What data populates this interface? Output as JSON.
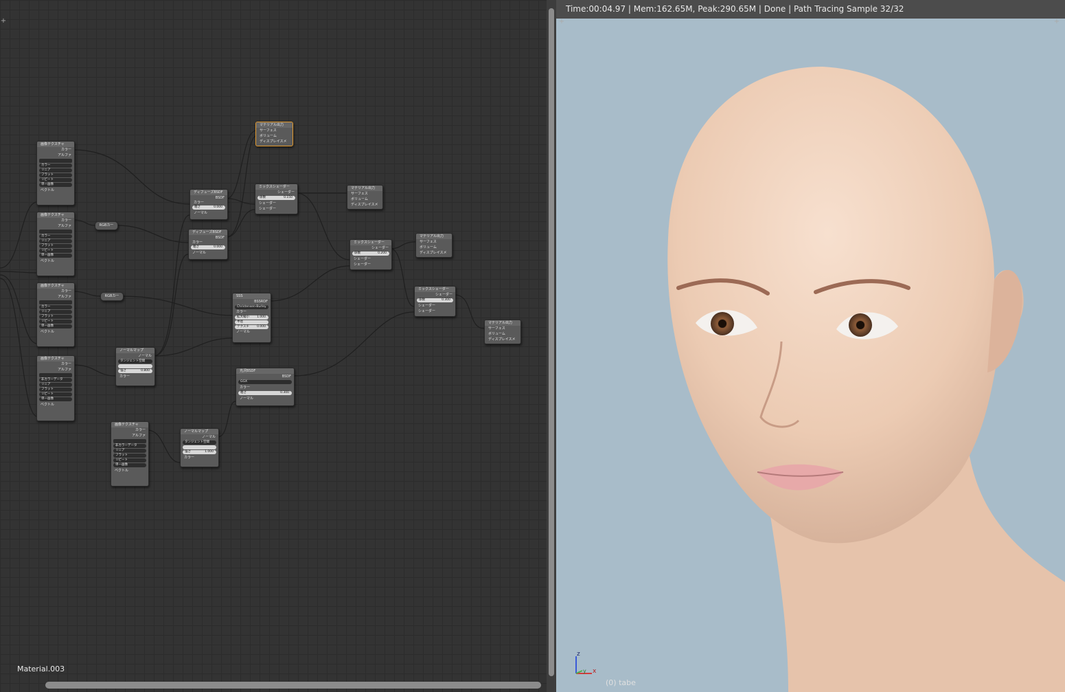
{
  "node_editor": {
    "material_name": "Material.003",
    "nodes": {
      "tex1": {
        "title": "画像テクスチャ",
        "color": "カラー",
        "alpha": "アルファ",
        "f1": "カラー",
        "f2": "リニア",
        "f3": "フラット",
        "f4": "リピート",
        "f5": "単一画像",
        "vector": "ベクトル"
      },
      "tex2": {
        "title": "画像テクスチャ",
        "color": "カラー",
        "alpha": "アルファ",
        "f1": "カラー",
        "f2": "リニア",
        "f3": "フラット",
        "f4": "リピート",
        "f5": "単一画像",
        "vector": "ベクトル"
      },
      "tex3": {
        "title": "画像テクスチャ",
        "color": "カラー",
        "alpha": "アルファ",
        "f1": "カラー",
        "f2": "リニア",
        "f3": "フラット",
        "f4": "リピート",
        "f5": "単一画像",
        "vector": "ベクトル"
      },
      "tex4": {
        "title": "画像テクスチャ",
        "color": "カラー",
        "alpha": "アルファ",
        "f1": "非カラーデータ",
        "f2": "リニア",
        "f3": "フラット",
        "f4": "リピート",
        "f5": "単一画像",
        "vector": "ベクトル"
      },
      "tex5": {
        "title": "画像テクスチャ",
        "color": "カラー",
        "alpha": "アルファ",
        "f1": "非カラーデータ",
        "f2": "リニア",
        "f3": "フラット",
        "f4": "リピート",
        "f5": "単一画像",
        "vector": "ベクトル"
      },
      "reroute1": {
        "label": "RGBカー"
      },
      "reroute2": {
        "label": "RGBカー"
      },
      "diffuse1": {
        "title": "ディフューズBSDF",
        "out": "BSDF",
        "color": "カラー",
        "rough_label": "粗さ",
        "rough_value": "0.000",
        "normal": "ノーマル"
      },
      "diffuse2": {
        "title": "ディフューズBSDF",
        "out": "BSDF",
        "color": "カラー",
        "rough_label": "粗さ",
        "rough_value": "0.000",
        "normal": "ノーマル"
      },
      "matout_top": {
        "title": "マテリアル出力",
        "s": "サーフェス",
        "v": "ボリューム",
        "d": "ディスプレイスメ"
      },
      "mix1": {
        "title": "ミックスシェーダー",
        "out": "シェーダー",
        "fac_label": "係数",
        "fac_value": "0.150",
        "s1": "シェーダー",
        "s2": "シェーダー"
      },
      "matout2": {
        "title": "マテリアル出力",
        "s": "サーフェス",
        "v": "ボリューム",
        "d": "ディスプレイスメ"
      },
      "mix2": {
        "title": "ミックスシェーダー",
        "out": "シェーダー",
        "fac_label": "係数",
        "fac_value": "0.200",
        "s1": "シェーダー",
        "s2": "シェーダー"
      },
      "matout3": {
        "title": "マテリアル出力",
        "s": "サーフェス",
        "v": "ボリューム",
        "d": "ディスプレイスメ"
      },
      "sss": {
        "title": "SSS",
        "out": "BSSRDF",
        "method": "Christensen-Burley",
        "color": "カラー",
        "scale_label": "拡大縮小",
        "scale_value": "1.000",
        "radius": "半径",
        "tex_label": "テクスチ",
        "tex_value": "0.000",
        "normal": "ノーマル"
      },
      "mix3": {
        "title": "ミックスシェーダー",
        "out": "シェーダー",
        "fac_label": "係数",
        "fac_value": "0.300",
        "s1": "シェーダー",
        "s2": "シェーダー"
      },
      "matout4": {
        "title": "マテリアル出力",
        "s": "サーフェス",
        "v": "ボリューム",
        "d": "ディスプレイスメ"
      },
      "normalmap1": {
        "title": "ノーマルマップ",
        "out": "ノーマル",
        "space": "タンジェント空間",
        "strength_label": "強さ",
        "strength_value": "0.800",
        "color": "カラー"
      },
      "gloss": {
        "title": "光沢BSDF",
        "out": "BSDF",
        "dist": "GGX",
        "color": "カラー",
        "rough_label": "粗さ",
        "rough_value": "0.300",
        "normal": "ノーマル"
      },
      "normalmap2": {
        "title": "ノーマルマップ",
        "out": "ノーマル",
        "space": "タンジェント空間",
        "strength_label": "強さ",
        "strength_value": "1.000",
        "color": "カラー"
      }
    }
  },
  "viewport": {
    "status": "Time:00:04.97 | Mem:162.65M, Peak:290.65M | Done | Path Tracing Sample 32/32",
    "object_label": "(0) tabe",
    "axes": {
      "z": "z",
      "y": "y",
      "x": "x"
    }
  },
  "colors": {
    "active_node": "#e39a2e",
    "background_vp": "#a8bcc9",
    "grid": "#333333"
  }
}
